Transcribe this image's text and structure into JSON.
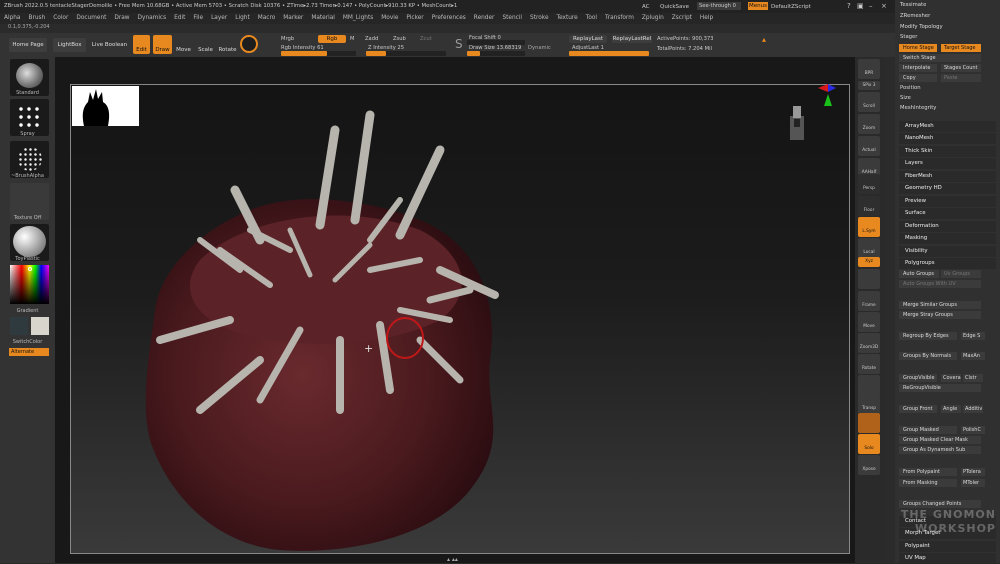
{
  "titlebar": "ZBrush 2022.0.5 tentacleStagerDemolile  • Free Mem 10.68GB • Active Mem 5703 • Scratch Disk 10376 • ZTime▸2.73 Timer▸0.147 • PolyCount▸910.33 KP • MeshCount▸1",
  "title_right": {
    "ac": "AC",
    "quicksave": "QuickSave",
    "seethrough": "See-through  0",
    "menus": "Menus",
    "script": "DefaultZScript"
  },
  "menus": [
    "Alpha",
    "Brush",
    "Color",
    "Document",
    "Draw",
    "Dynamics",
    "Edit",
    "File",
    "Layer",
    "Light",
    "Macro",
    "Marker",
    "Material",
    "MM_Lights",
    "Movie",
    "Picker",
    "Preferences",
    "Render",
    "Stencil",
    "Stroke",
    "Texture",
    "Tool",
    "Transform",
    "Zplugin",
    "Zscript",
    "Help"
  ],
  "coords": "0.1,0.375,-0.204",
  "shelf": {
    "home_page": "Home Page",
    "lightbox": "LightBox",
    "live_boolean": "Live Boolean",
    "edit": "Edit",
    "draw": "Draw",
    "move": "Move",
    "scale": "Scale",
    "rotate": "Rotate",
    "mrgb": "Mrgb",
    "rgb": "Rgb",
    "m": "M",
    "rgb_intensity": "Rgb Intensity 61",
    "zadd": "Zadd",
    "zsub": "Zsub",
    "zcut": "Zcut",
    "z_intensity": "Z Intensity 25",
    "focal_shift": "Focal Shift 0",
    "draw_size": "Draw Size 13.68319",
    "dynamic": "Dynamic",
    "replay_last": "ReplayLast",
    "replay_last_rel": "ReplayLastRel",
    "adjust_last": "AdjustLast  1",
    "active_points": "ActivePoints: 900,373",
    "total_points": "TotalPoints: 7.204 Mil"
  },
  "left_tray": {
    "standard": "Standard",
    "spray": "Spray",
    "brush_alpha": "~BrushAlpha",
    "texture_off": "Texture Off",
    "material": "ToyPlastic",
    "gradient": "Gradient",
    "switch_color": "SwitchColor",
    "alternate": "Alternate"
  },
  "right_tray": [
    "BPR",
    "SPix 3",
    "Scroll",
    "Zoom",
    "Actual",
    "AAHalf",
    "Persp",
    "Floor",
    "L.Sym",
    "Local",
    "Xyz",
    "",
    "Frame",
    "Move",
    "Zoom3D",
    "Rotate",
    "",
    "Transp",
    "",
    "Solo",
    "Xpose"
  ],
  "panel_top": [
    "Tessimate",
    "ZRemesher",
    "Modify Topology",
    "Stager"
  ],
  "home_stage": "Home Stage",
  "target_stage": "Target Stage",
  "switch_stage": "Switch Stage",
  "interpolate": "Interpolate",
  "stages_count": "Stages Count",
  "copy": "Copy",
  "paste": "Paste",
  "position": "Position",
  "size": "Size",
  "mesh_integrity": "MeshIntegrity",
  "subpalettes": [
    "ArrayMesh",
    "NanoMesh",
    "Thick Skin",
    "Layers",
    "FiberMesh",
    "Geometry HD",
    "Preview",
    "Surface",
    "Deformation",
    "Masking",
    "Visibility",
    "Polygroups"
  ],
  "polygroups": {
    "auto_groups": "Auto Groups",
    "uv_groups": "Uv Groups",
    "auto_groups_uv": "Auto Groups With UV",
    "merge_similar": "Merge Similar Groups",
    "merge_stray": "Merge Stray Groups",
    "regroup_edges": "Regroup By Edges",
    "edge_s": "Edge S",
    "groups_normals": "Groups By Normals",
    "maxan": "MaxAn",
    "group_visible": "GroupVisible",
    "coverage": "Covera",
    "clust": "Clstr",
    "regroup_visible": "ReGroupVisible",
    "group_front": "Group Front",
    "angle": "Angle",
    "additive": "Additiv",
    "group_masked": "Group Masked",
    "polish": "PolishC",
    "group_masked_clear": "Group Masked Clear Mask",
    "group_dynamesh": "Group As Dynamesh Sub",
    "from_polypaint": "From Polypaint",
    "ptolerance": "PTolera",
    "from_masking": "From Masking",
    "mtolerance": "MToler",
    "groups_changed": "Groups Changed Points"
  },
  "panel_bottom": [
    "Contact",
    "Morph Target",
    "Polypaint",
    "UV Map"
  ],
  "watermark": "THE GNOMON WORKSHOP",
  "colors": {
    "accent": "#e8891f",
    "panel": "#303030",
    "shelf": "#333333"
  }
}
